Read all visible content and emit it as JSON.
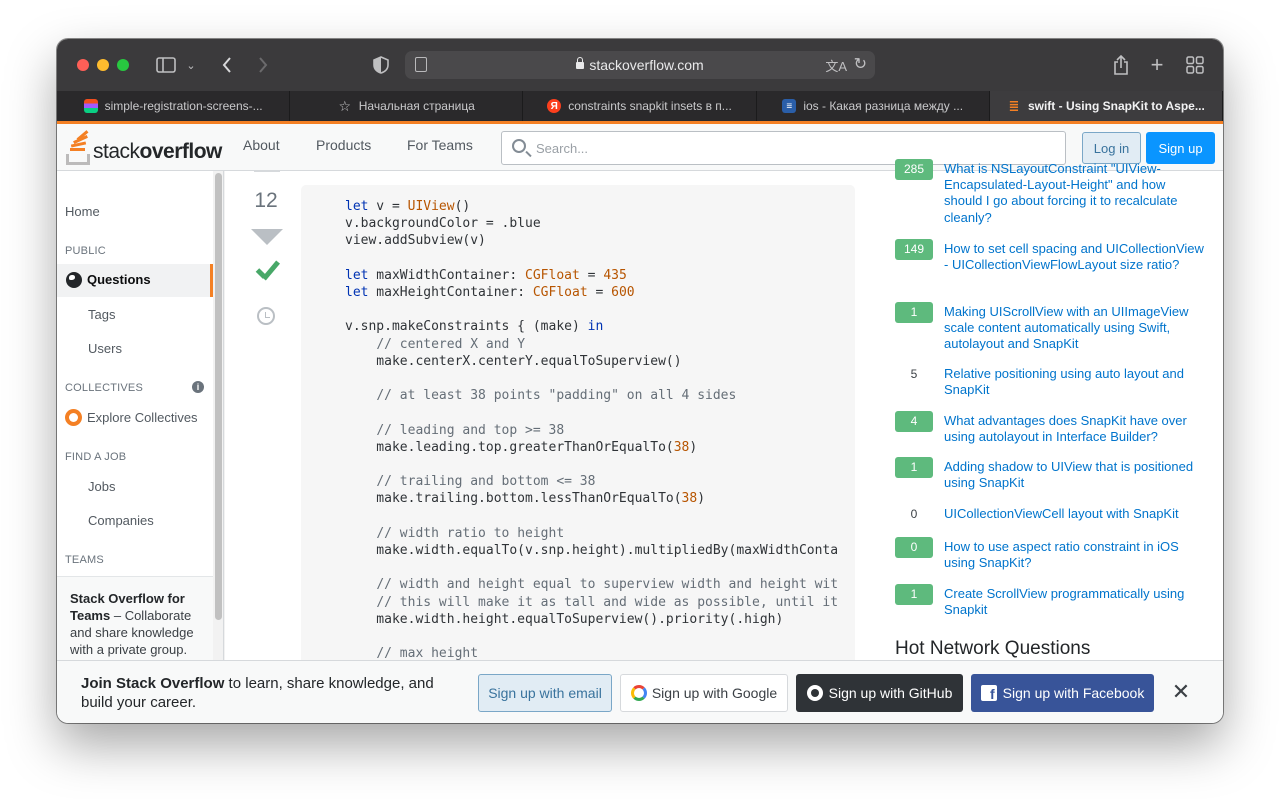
{
  "browser": {
    "url": "stackoverflow.com",
    "tabs": [
      {
        "title": "simple-registration-screens-...",
        "favicon": "figma-icon"
      },
      {
        "title": "Начальная страница",
        "favicon": "star-icon"
      },
      {
        "title": "constraints snapkit insets в п...",
        "favicon": "yandex-icon"
      },
      {
        "title": "ios - Какая разница между ...",
        "favicon": "stackoverflow-ru-icon"
      },
      {
        "title": "swift - Using SnapKit to Aspe...",
        "favicon": "stackoverflow-icon"
      }
    ]
  },
  "header": {
    "logo_light": "stack",
    "logo_bold": "overflow",
    "nav": [
      "About",
      "Products",
      "For Teams"
    ],
    "search_placeholder": "Search...",
    "login_label": "Log in",
    "signup_label": "Sign up",
    "accent": "#f48024"
  },
  "sidebar": {
    "home": "Home",
    "public_heading": "PUBLIC",
    "questions": "Questions",
    "tags": "Tags",
    "users": "Users",
    "collectives_heading": "COLLECTIVES",
    "explore_collectives": "Explore Collectives",
    "job_heading": "FIND A JOB",
    "jobs": "Jobs",
    "companies": "Companies",
    "teams_heading": "TEAMS",
    "teams_title": "Stack Overflow for Teams",
    "teams_text": " – Collaborate and share knowledge with a private group."
  },
  "post": {
    "votes": "12"
  },
  "related": [
    {
      "count": "285",
      "title": "What is NSLayoutConstraint \"UIView-Encapsulated-Layout-Height\" and how should I go about forcing it to recalculate cleanly?",
      "answered": true
    },
    {
      "count": "149",
      "title": "How to set cell spacing and UICollectionView - UICollectionViewFlowLayout size ratio?",
      "answered": true
    },
    {
      "count": "1",
      "title": "Making UIScrollView with an UIImageView scale content automatically using Swift, autolayout and SnapKit",
      "answered": true
    },
    {
      "count": "5",
      "title": "Relative positioning using auto layout and SnapKit",
      "answered": false
    },
    {
      "count": "4",
      "title": "What advantages does SnapKit have over using autolayout in Interface Builder?",
      "answered": true
    },
    {
      "count": "1",
      "title": "Adding shadow to UIView that is positioned using SnapKit",
      "answered": true
    },
    {
      "count": "0",
      "title": "UICollectionViewCell layout with SnapKit",
      "answered": false
    },
    {
      "count": "0",
      "title": "How to use aspect ratio constraint in iOS using SnapKit?",
      "answered": true
    },
    {
      "count": "1",
      "title": "Create ScrollView programmatically using Snapkit",
      "answered": true
    }
  ],
  "hot_network_title": "Hot Network Questions",
  "banner": {
    "message_bold": "Join Stack Overflow",
    "message_rest": " to learn, share knowledge, and build your career.",
    "email_label": "Sign up with email",
    "google_label": "Sign up with Google",
    "github_label": "Sign up with GitHub",
    "facebook_label": "Sign up with Facebook",
    "close_label": "✕"
  }
}
